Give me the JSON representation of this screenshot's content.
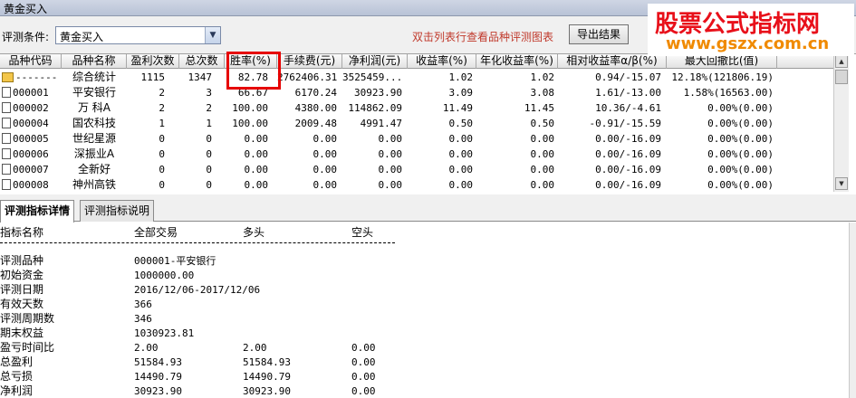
{
  "window": {
    "title": "黄金买入"
  },
  "toolbar": {
    "condition_label": "评测条件:",
    "condition_value": "黄金买入",
    "hint": "双击列表行查看品种评测图表",
    "export_label": "导出结果"
  },
  "watermark": {
    "title": "股票公式指标网",
    "url": "www.gszx.com.cn"
  },
  "grid": {
    "columns": [
      "品种代码",
      "品种名称",
      "盈利次数",
      "总次数",
      "胜率(%)",
      "手续费(元)",
      "净利润(元)",
      "收益率(%)",
      "年化收益率(%)",
      "相对收益率α/β(%)",
      "最大回撤比(值)"
    ],
    "rows": [
      {
        "code": "-------",
        "name": "综合统计",
        "wins": "1115",
        "total": "1347",
        "winrate": "82.78",
        "fee": "2762406.31",
        "profit": "3525459...",
        "ret": "1.02",
        "annual": "1.02",
        "alpha": "0.94/-15.07",
        "drawdown": "12.18%(121806.19)"
      },
      {
        "code": "000001",
        "name": "平安银行",
        "wins": "2",
        "total": "3",
        "winrate": "66.67",
        "fee": "6170.24",
        "profit": "30923.90",
        "ret": "3.09",
        "annual": "3.08",
        "alpha": "1.61/-13.00",
        "drawdown": "1.58%(16563.00)"
      },
      {
        "code": "000002",
        "name": "万  科A",
        "wins": "2",
        "total": "2",
        "winrate": "100.00",
        "fee": "4380.00",
        "profit": "114862.09",
        "ret": "11.49",
        "annual": "11.45",
        "alpha": "10.36/-4.61",
        "drawdown": "0.00%(0.00)"
      },
      {
        "code": "000004",
        "name": "国农科技",
        "wins": "1",
        "total": "1",
        "winrate": "100.00",
        "fee": "2009.48",
        "profit": "4991.47",
        "ret": "0.50",
        "annual": "0.50",
        "alpha": "-0.91/-15.59",
        "drawdown": "0.00%(0.00)"
      },
      {
        "code": "000005",
        "name": "世纪星源",
        "wins": "0",
        "total": "0",
        "winrate": "0.00",
        "fee": "0.00",
        "profit": "0.00",
        "ret": "0.00",
        "annual": "0.00",
        "alpha": "0.00/-16.09",
        "drawdown": "0.00%(0.00)"
      },
      {
        "code": "000006",
        "name": "深振业A",
        "wins": "0",
        "total": "0",
        "winrate": "0.00",
        "fee": "0.00",
        "profit": "0.00",
        "ret": "0.00",
        "annual": "0.00",
        "alpha": "0.00/-16.09",
        "drawdown": "0.00%(0.00)"
      },
      {
        "code": "000007",
        "name": "全新好",
        "wins": "0",
        "total": "0",
        "winrate": "0.00",
        "fee": "0.00",
        "profit": "0.00",
        "ret": "0.00",
        "annual": "0.00",
        "alpha": "0.00/-16.09",
        "drawdown": "0.00%(0.00)"
      },
      {
        "code": "000008",
        "name": "神州高铁",
        "wins": "0",
        "total": "0",
        "winrate": "0.00",
        "fee": "0.00",
        "profit": "0.00",
        "ret": "0.00",
        "annual": "0.00",
        "alpha": "0.00/-16.09",
        "drawdown": "0.00%(0.00)"
      }
    ]
  },
  "tabs": [
    "评测指标详情",
    "评测指标说明"
  ],
  "detail": {
    "headers": [
      "指标名称",
      "全部交易",
      "多头",
      "空头"
    ],
    "lines": [
      {
        "label": "评测品种",
        "all": "000001-平安银行",
        "long": "",
        "short": ""
      },
      {
        "label": "初始资金",
        "all": "1000000.00",
        "long": "",
        "short": ""
      },
      {
        "label": "评测日期",
        "all": "2016/12/06-2017/12/06",
        "long": "",
        "short": ""
      },
      {
        "label": "有效天数",
        "all": "366",
        "long": "",
        "short": ""
      },
      {
        "label": "评测周期数",
        "all": "346",
        "long": "",
        "short": ""
      },
      {
        "label": "期末权益",
        "all": "1030923.81",
        "long": "",
        "short": ""
      },
      {
        "label": "盈亏时间比",
        "all": "2.00",
        "long": "2.00",
        "short": "0.00"
      },
      {
        "label": "总盈利",
        "all": "51584.93",
        "long": "51584.93",
        "short": "0.00"
      },
      {
        "label": "总亏损",
        "all": "14490.79",
        "long": "14490.79",
        "short": "0.00"
      },
      {
        "label": "净利润",
        "all": "30923.90",
        "long": "30923.90",
        "short": "0.00"
      }
    ]
  }
}
